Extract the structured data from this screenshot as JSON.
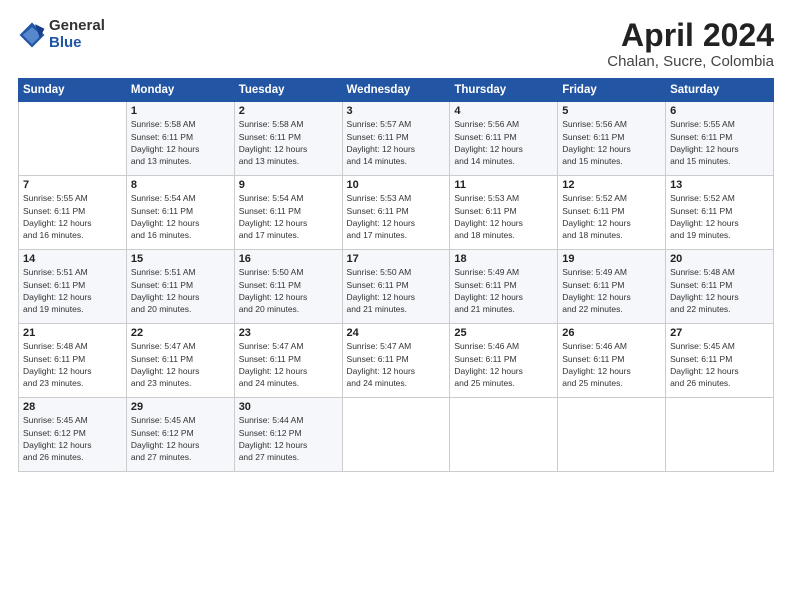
{
  "logo": {
    "general": "General",
    "blue": "Blue"
  },
  "title": "April 2024",
  "location": "Chalan, Sucre, Colombia",
  "days_header": [
    "Sunday",
    "Monday",
    "Tuesday",
    "Wednesday",
    "Thursday",
    "Friday",
    "Saturday"
  ],
  "weeks": [
    [
      {
        "num": "",
        "info": ""
      },
      {
        "num": "1",
        "info": "Sunrise: 5:58 AM\nSunset: 6:11 PM\nDaylight: 12 hours\nand 13 minutes."
      },
      {
        "num": "2",
        "info": "Sunrise: 5:58 AM\nSunset: 6:11 PM\nDaylight: 12 hours\nand 13 minutes."
      },
      {
        "num": "3",
        "info": "Sunrise: 5:57 AM\nSunset: 6:11 PM\nDaylight: 12 hours\nand 14 minutes."
      },
      {
        "num": "4",
        "info": "Sunrise: 5:56 AM\nSunset: 6:11 PM\nDaylight: 12 hours\nand 14 minutes."
      },
      {
        "num": "5",
        "info": "Sunrise: 5:56 AM\nSunset: 6:11 PM\nDaylight: 12 hours\nand 15 minutes."
      },
      {
        "num": "6",
        "info": "Sunrise: 5:55 AM\nSunset: 6:11 PM\nDaylight: 12 hours\nand 15 minutes."
      }
    ],
    [
      {
        "num": "7",
        "info": "Sunrise: 5:55 AM\nSunset: 6:11 PM\nDaylight: 12 hours\nand 16 minutes."
      },
      {
        "num": "8",
        "info": "Sunrise: 5:54 AM\nSunset: 6:11 PM\nDaylight: 12 hours\nand 16 minutes."
      },
      {
        "num": "9",
        "info": "Sunrise: 5:54 AM\nSunset: 6:11 PM\nDaylight: 12 hours\nand 17 minutes."
      },
      {
        "num": "10",
        "info": "Sunrise: 5:53 AM\nSunset: 6:11 PM\nDaylight: 12 hours\nand 17 minutes."
      },
      {
        "num": "11",
        "info": "Sunrise: 5:53 AM\nSunset: 6:11 PM\nDaylight: 12 hours\nand 18 minutes."
      },
      {
        "num": "12",
        "info": "Sunrise: 5:52 AM\nSunset: 6:11 PM\nDaylight: 12 hours\nand 18 minutes."
      },
      {
        "num": "13",
        "info": "Sunrise: 5:52 AM\nSunset: 6:11 PM\nDaylight: 12 hours\nand 19 minutes."
      }
    ],
    [
      {
        "num": "14",
        "info": "Sunrise: 5:51 AM\nSunset: 6:11 PM\nDaylight: 12 hours\nand 19 minutes."
      },
      {
        "num": "15",
        "info": "Sunrise: 5:51 AM\nSunset: 6:11 PM\nDaylight: 12 hours\nand 20 minutes."
      },
      {
        "num": "16",
        "info": "Sunrise: 5:50 AM\nSunset: 6:11 PM\nDaylight: 12 hours\nand 20 minutes."
      },
      {
        "num": "17",
        "info": "Sunrise: 5:50 AM\nSunset: 6:11 PM\nDaylight: 12 hours\nand 21 minutes."
      },
      {
        "num": "18",
        "info": "Sunrise: 5:49 AM\nSunset: 6:11 PM\nDaylight: 12 hours\nand 21 minutes."
      },
      {
        "num": "19",
        "info": "Sunrise: 5:49 AM\nSunset: 6:11 PM\nDaylight: 12 hours\nand 22 minutes."
      },
      {
        "num": "20",
        "info": "Sunrise: 5:48 AM\nSunset: 6:11 PM\nDaylight: 12 hours\nand 22 minutes."
      }
    ],
    [
      {
        "num": "21",
        "info": "Sunrise: 5:48 AM\nSunset: 6:11 PM\nDaylight: 12 hours\nand 23 minutes."
      },
      {
        "num": "22",
        "info": "Sunrise: 5:47 AM\nSunset: 6:11 PM\nDaylight: 12 hours\nand 23 minutes."
      },
      {
        "num": "23",
        "info": "Sunrise: 5:47 AM\nSunset: 6:11 PM\nDaylight: 12 hours\nand 24 minutes."
      },
      {
        "num": "24",
        "info": "Sunrise: 5:47 AM\nSunset: 6:11 PM\nDaylight: 12 hours\nand 24 minutes."
      },
      {
        "num": "25",
        "info": "Sunrise: 5:46 AM\nSunset: 6:11 PM\nDaylight: 12 hours\nand 25 minutes."
      },
      {
        "num": "26",
        "info": "Sunrise: 5:46 AM\nSunset: 6:11 PM\nDaylight: 12 hours\nand 25 minutes."
      },
      {
        "num": "27",
        "info": "Sunrise: 5:45 AM\nSunset: 6:11 PM\nDaylight: 12 hours\nand 26 minutes."
      }
    ],
    [
      {
        "num": "28",
        "info": "Sunrise: 5:45 AM\nSunset: 6:12 PM\nDaylight: 12 hours\nand 26 minutes."
      },
      {
        "num": "29",
        "info": "Sunrise: 5:45 AM\nSunset: 6:12 PM\nDaylight: 12 hours\nand 27 minutes."
      },
      {
        "num": "30",
        "info": "Sunrise: 5:44 AM\nSunset: 6:12 PM\nDaylight: 12 hours\nand 27 minutes."
      },
      {
        "num": "",
        "info": ""
      },
      {
        "num": "",
        "info": ""
      },
      {
        "num": "",
        "info": ""
      },
      {
        "num": "",
        "info": ""
      }
    ]
  ]
}
